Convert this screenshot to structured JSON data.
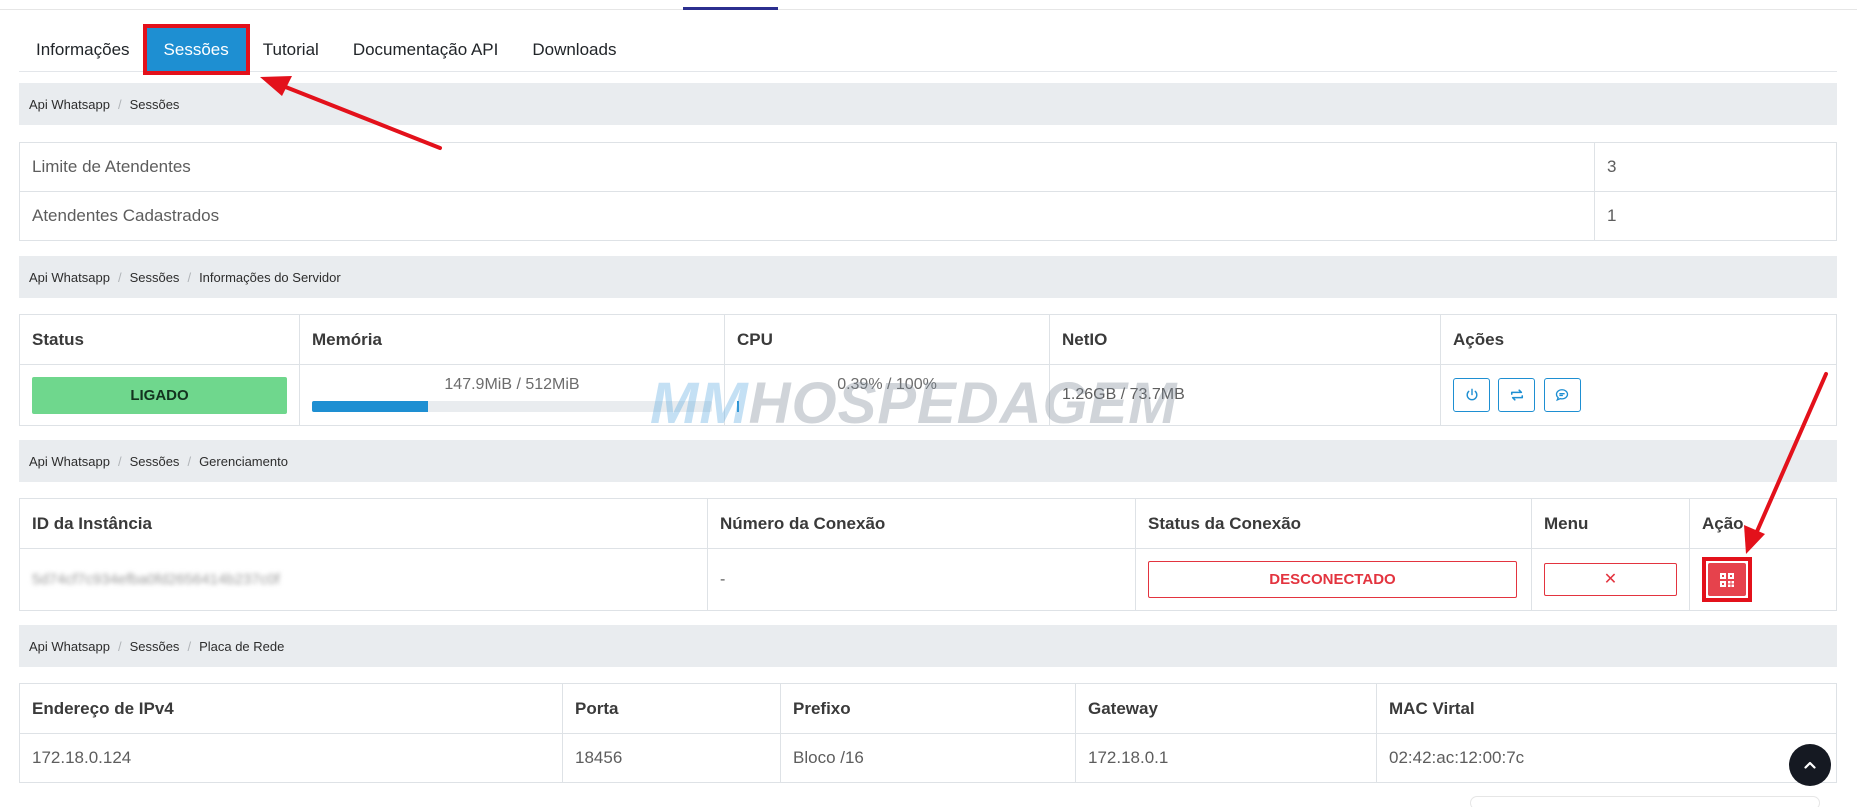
{
  "tabs": [
    "Informações",
    "Sessões",
    "Tutorial",
    "Documentação API",
    "Downloads"
  ],
  "breadcrumbs": {
    "sessions": [
      "Api Whatsapp",
      "Sessões"
    ],
    "server": [
      "Api Whatsapp",
      "Sessões",
      "Informações do Servidor"
    ],
    "manage": [
      "Api Whatsapp",
      "Sessões",
      "Gerenciamento"
    ],
    "network": [
      "Api Whatsapp",
      "Sessões",
      "Placa de Rede"
    ]
  },
  "limits": {
    "rows": [
      {
        "label": "Limite de Atendentes",
        "value": "3"
      },
      {
        "label": "Atendentes Cadastrados",
        "value": "1"
      }
    ]
  },
  "server": {
    "headers": [
      "Status",
      "Memória",
      "CPU",
      "NetIO",
      "Ações"
    ],
    "status": "LIGADO",
    "memory_text": "147.9MiB / 512MiB",
    "memory_fraction": 0.29,
    "cpu_text": "0.39% / 100%",
    "cpu_fraction": 0.0039,
    "netio": "1.26GB / 73.7MB",
    "actions": [
      "power-icon",
      "restart-icon",
      "chat-icon"
    ]
  },
  "manage": {
    "headers": [
      "ID da Instância",
      "Número da Conexão",
      "Status da Conexão",
      "Menu",
      "Ação"
    ],
    "instance_id": "5d74cf7c934efba0fd2656414b237c0f",
    "connection_number": "-",
    "connection_status": "DESCONECTADO",
    "menu_symbol": "✕"
  },
  "network": {
    "headers": [
      "Endereço de IPv4",
      "Porta",
      "Prefixo",
      "Gateway",
      "MAC Virtal"
    ],
    "ipv4": "172.18.0.124",
    "port": "18456",
    "prefix": "Bloco /16",
    "gateway": "172.18.0.1",
    "mac": "02:42:ac:12:00:7c"
  },
  "watermark": {
    "part1": "MM",
    "part2": "HOSPEDAGEM"
  },
  "colors": {
    "accent": "#1e8fd2",
    "success": "#6fd78d",
    "danger": "#e3343f",
    "highlight": "#e3111b"
  }
}
